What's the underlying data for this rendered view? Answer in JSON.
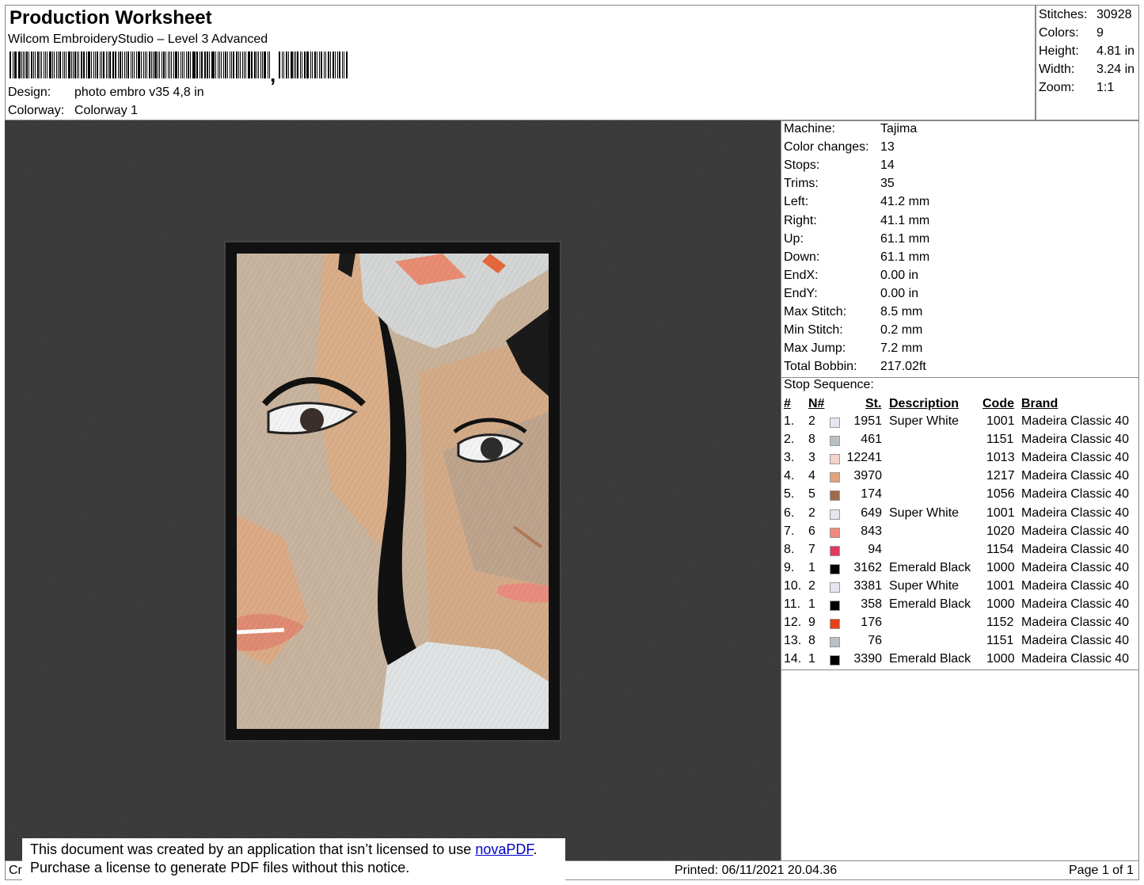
{
  "header": {
    "title": "Production Worksheet",
    "subtitle": "Wilcom EmbroideryStudio – Level 3 Advanced",
    "design_label": "Design:",
    "design_value": "photo embro v35 4,8 in",
    "colorway_label": "Colorway:",
    "colorway_value": "Colorway 1",
    "barcode_comma": ","
  },
  "stats": [
    {
      "k": "Stitches:",
      "v": "30928"
    },
    {
      "k": "Colors:",
      "v": "9"
    },
    {
      "k": "Height:",
      "v": "4.81 in"
    },
    {
      "k": "Width:",
      "v": "3.24 in"
    },
    {
      "k": "Zoom:",
      "v": "1:1"
    }
  ],
  "info": [
    {
      "k": "Machine:",
      "v": "Tajima"
    },
    {
      "k": "Color changes:",
      "v": "13"
    },
    {
      "k": "Stops:",
      "v": "14"
    },
    {
      "k": "Trims:",
      "v": "35"
    },
    {
      "k": "Left:",
      "v": "41.2 mm"
    },
    {
      "k": "Right:",
      "v": "41.1 mm"
    },
    {
      "k": "Up:",
      "v": "61.1 mm"
    },
    {
      "k": "Down:",
      "v": "61.1 mm"
    },
    {
      "k": "EndX:",
      "v": "0.00 in"
    },
    {
      "k": "EndY:",
      "v": "0.00 in"
    },
    {
      "k": "Max Stitch:",
      "v": "8.5 mm"
    },
    {
      "k": "Min Stitch:",
      "v": "0.2 mm"
    },
    {
      "k": "Max Jump:",
      "v": "7.2 mm"
    },
    {
      "k": "Total Bobbin:",
      "v": "217.02ft"
    }
  ],
  "sequence": {
    "title": "Stop Sequence:",
    "headers": {
      "num": "#",
      "n": "N#",
      "st": "St.",
      "desc": "Description",
      "code": "Code",
      "brand": "Brand"
    },
    "rows": [
      {
        "num": "1.",
        "n": "2",
        "color": "#e6e6f2",
        "st": "1951",
        "desc": "Super White",
        "code": "1001",
        "brand": "Madeira Classic 40"
      },
      {
        "num": "2.",
        "n": "8",
        "color": "#b9c0c3",
        "st": "461",
        "desc": "",
        "code": "1151",
        "brand": "Madeira Classic 40"
      },
      {
        "num": "3.",
        "n": "3",
        "color": "#f3d3ca",
        "st": "12241",
        "desc": "",
        "code": "1013",
        "brand": "Madeira Classic 40"
      },
      {
        "num": "4.",
        "n": "4",
        "color": "#e4a27e",
        "st": "3970",
        "desc": "",
        "code": "1217",
        "brand": "Madeira Classic 40"
      },
      {
        "num": "5.",
        "n": "5",
        "color": "#a0694d",
        "st": "174",
        "desc": "",
        "code": "1056",
        "brand": "Madeira Classic 40"
      },
      {
        "num": "6.",
        "n": "2",
        "color": "#e6e6f2",
        "st": "649",
        "desc": "Super White",
        "code": "1001",
        "brand": "Madeira Classic 40"
      },
      {
        "num": "7.",
        "n": "6",
        "color": "#f18a7d",
        "st": "843",
        "desc": "",
        "code": "1020",
        "brand": "Madeira Classic 40"
      },
      {
        "num": "8.",
        "n": "7",
        "color": "#dd3a5e",
        "st": "94",
        "desc": "",
        "code": "1154",
        "brand": "Madeira Classic 40"
      },
      {
        "num": "9.",
        "n": "1",
        "color": "#000000",
        "st": "3162",
        "desc": "Emerald Black",
        "code": "1000",
        "brand": "Madeira Classic 40"
      },
      {
        "num": "10.",
        "n": "2",
        "color": "#e6e6f2",
        "st": "3381",
        "desc": "Super White",
        "code": "1001",
        "brand": "Madeira Classic 40"
      },
      {
        "num": "11.",
        "n": "1",
        "color": "#000000",
        "st": "358",
        "desc": "Emerald Black",
        "code": "1000",
        "brand": "Madeira Classic 40"
      },
      {
        "num": "12.",
        "n": "9",
        "color": "#e6401c",
        "st": "176",
        "desc": "",
        "code": "1152",
        "brand": "Madeira Classic 40"
      },
      {
        "num": "13.",
        "n": "8",
        "color": "#b9c0c3",
        "st": "76",
        "desc": "",
        "code": "1151",
        "brand": "Madeira Classic 40"
      },
      {
        "num": "14.",
        "n": "1",
        "color": "#000000",
        "st": "3390",
        "desc": "Emerald Black",
        "code": "1000",
        "brand": "Madeira Classic 40"
      }
    ]
  },
  "footer": {
    "left": "Cr",
    "printed": "Printed: 06/11/2021 20.04.36",
    "page": "Page 1 of 1"
  },
  "notice": {
    "line1_pre": "This document was created by an application that isn’t licensed to use ",
    "link": "novaPDF",
    "line1_post": ".",
    "line2": "Purchase a license to generate PDF files without this notice."
  }
}
